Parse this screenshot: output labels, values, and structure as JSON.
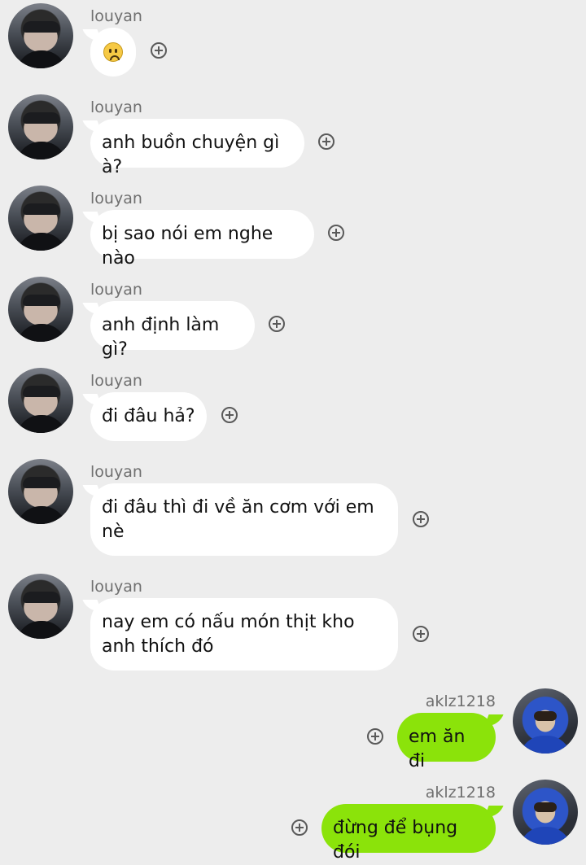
{
  "contacts": {
    "them": {
      "name": "louyan",
      "avatar": "louyan-avatar"
    },
    "me": {
      "name": "aklz1218",
      "avatar": "aklz1218-avatar"
    }
  },
  "messages": [
    {
      "sender": "louyan",
      "text": "",
      "emoji": "confused-face-emoji"
    },
    {
      "sender": "louyan",
      "text": "anh buồn chuyện gì à?"
    },
    {
      "sender": "louyan",
      "text": "bị sao nói em nghe nào"
    },
    {
      "sender": "louyan",
      "text": "anh định làm gì?"
    },
    {
      "sender": "louyan",
      "text": "đi đâu hả?"
    },
    {
      "sender": "louyan",
      "text": "đi đâu thì đi về ăn cơm với em nè"
    },
    {
      "sender": "louyan",
      "text": "nay em có nấu món thịt kho anh thích đó"
    },
    {
      "sender": "aklz1218",
      "text": "em ăn đi"
    },
    {
      "sender": "aklz1218",
      "text": "đừng để bụng đói"
    }
  ],
  "colors": {
    "background": "#ededed",
    "incoming_bubble": "#ffffff",
    "outgoing_bubble": "#8be30a",
    "sender_name": "#6f6f6f"
  },
  "icons": {
    "reaction": "add-reaction-icon"
  }
}
